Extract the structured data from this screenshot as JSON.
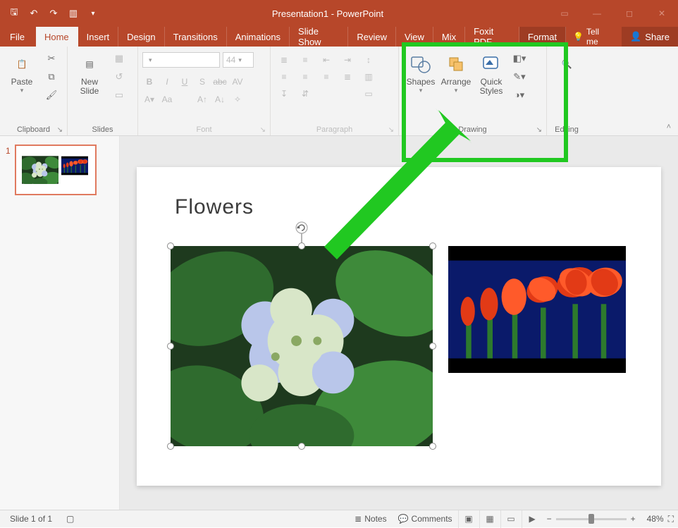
{
  "title": "Presentation1 - PowerPoint",
  "tabs": {
    "file": "File",
    "home": "Home",
    "insert": "Insert",
    "design": "Design",
    "transitions": "Transitions",
    "animations": "Animations",
    "slideshow": "Slide Show",
    "review": "Review",
    "view": "View",
    "mix": "Mix",
    "foxit": "Foxit PDF",
    "format": "Format",
    "tell_me": "Tell me",
    "share": "Share"
  },
  "ribbon": {
    "clipboard": {
      "label": "Clipboard",
      "paste": "Paste"
    },
    "slides": {
      "label": "Slides",
      "new_slide": "New\nSlide"
    },
    "font": {
      "label": "Font",
      "size": "44"
    },
    "paragraph": {
      "label": "Paragraph"
    },
    "drawing": {
      "label": "Drawing",
      "shapes": "Shapes",
      "arrange": "Arrange",
      "quick_styles": "Quick\nStyles"
    },
    "editing": {
      "label": "Editing"
    }
  },
  "slide": {
    "title": "Flowers"
  },
  "thumbs": {
    "n1": "1"
  },
  "status": {
    "slide": "Slide 1 of 1",
    "notes": "Notes",
    "comments": "Comments",
    "zoom": "48%"
  }
}
